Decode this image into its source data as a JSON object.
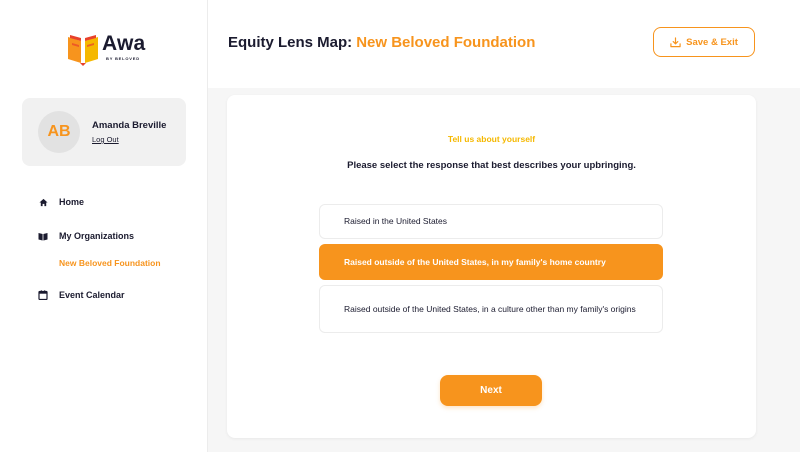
{
  "app": {
    "logo_word": "Awa",
    "logo_sub": "BY BELOVED",
    "accent_color": "#f7941d"
  },
  "user": {
    "initials": "AB",
    "name": "Amanda Breville",
    "logout_label": "Log Out"
  },
  "nav": {
    "home": "Home",
    "organizations": "My Organizations",
    "current_org": "New Beloved Foundation",
    "calendar": "Event Calendar"
  },
  "header": {
    "title": "Equity Lens Map:",
    "org": "New Beloved Foundation",
    "save_label": "Save & Exit"
  },
  "form": {
    "eyebrow": "Tell us about yourself",
    "question": "Please select the response that best describes your upbringing.",
    "options": [
      {
        "label": "Raised in the United States",
        "selected": false
      },
      {
        "label": "Raised outside of the United States, in my family's home country",
        "selected": true
      },
      {
        "label": "Raised outside of the United States, in a culture other than my family's origins",
        "selected": false
      }
    ],
    "next_label": "Next"
  },
  "icons": {
    "home": "home-icon",
    "organizations": "book-icon",
    "calendar": "calendar-icon",
    "save": "download-icon"
  }
}
